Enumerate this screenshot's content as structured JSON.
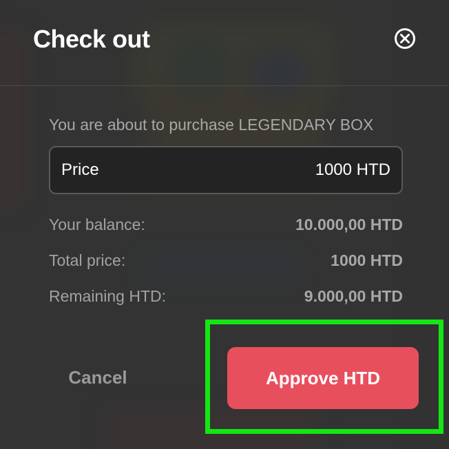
{
  "dialog": {
    "title": "Check out",
    "close_icon": "close-circle-icon"
  },
  "purchase": {
    "intro": "You are about to purchase LEGENDARY BOX",
    "price_label": "Price",
    "price_value": "1000 HTD"
  },
  "summary": [
    {
      "label": "Your balance:",
      "value": "10.000,00 HTD"
    },
    {
      "label": "Total price:",
      "value": "1000 HTD"
    },
    {
      "label": "Remaining HTD:",
      "value": "9.000,00 HTD"
    }
  ],
  "actions": {
    "cancel_label": "Cancel",
    "approve_label": "Approve HTD"
  },
  "colors": {
    "approve": "#e84f5d",
    "highlight": "#14e614"
  }
}
